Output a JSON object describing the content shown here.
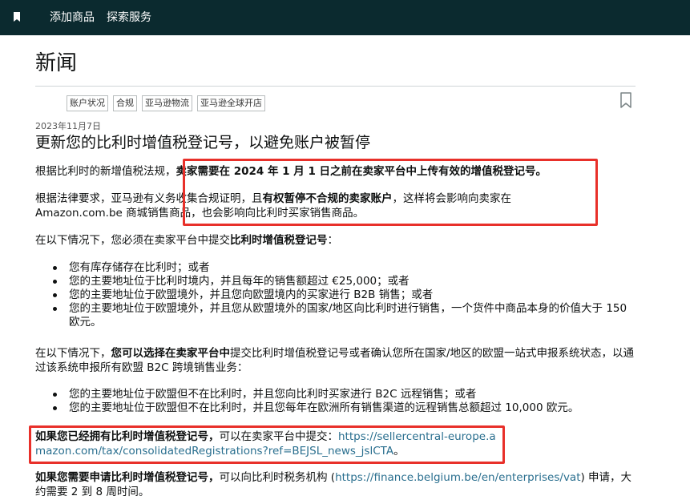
{
  "topbar": {
    "icon": "bookmark-icon",
    "links": [
      "添加商品",
      "探索服务"
    ]
  },
  "page": {
    "title": "新闻",
    "tags": [
      "账户状况",
      "合规",
      "亚马逊物流",
      "亚马逊全球开店"
    ],
    "save_icon": "bookmark-outline-icon",
    "date": "2023年11月7日",
    "headline": "更新您的比利时增值税登记号，以避免账户被暂停"
  },
  "article": {
    "p1_prefix": "根据比利时的新增值税法规，",
    "p1_bold": "卖家需要在 2024 年 1 月 1 日之前在卖家平台中上传有效的增值税登记号。",
    "p2_prefix": "根据法律要求，亚马逊有义务收集合规证明，且",
    "p2_bold": "有权暂停不合规的卖家账户",
    "p2_suffix": "，这样将会影响向卖家在 Amazon.com.be 商城销售商品，也会影响向比利时买家销售商品。",
    "p3_prefix": "在以下情况下，您必须在卖家平台中提交",
    "p3_bold": "比利时增值税登记号",
    "p3_suffix": "：",
    "list1": [
      "您有库存储存在比利时；或者",
      "您的主要地址位于比利时境内，并且每年的销售额超过 €25,000；或者",
      "您的主要地址位于欧盟境外，并且您向欧盟境内的买家进行 B2B 销售；或者",
      "您的主要地址位于欧盟境外，并且您从欧盟境外的国家/地区向比利时进行销售，一个货件中商品本身的价值大于 150 欧元。"
    ],
    "p4_prefix": "在以下情况下，",
    "p4_bold": "您可以选择在卖家平台中",
    "p4_suffix": "提交比利时增值税登记号或者确认您所在国家/地区的欧盟一站式申报系统状态，以通过该系统申报所有欧盟 B2C 跨境销售业务：",
    "list2": [
      "您的主要地址位于欧盟但不在比利时，并且您向比利时买家进行 B2C 远程销售；或者",
      "您的主要地址位于欧盟但不在比利时，并且您每年在欧洲所有销售渠道的远程销售总额超过 10,000 欧元。"
    ],
    "p5_bold": "如果您已经拥有比利时增值税登记号，",
    "p5_mid": "可以在卖家平台中提交：",
    "p5_link": "https://sellercentral-europe.amazon.com/tax/consolidatedRegistrations?ref=BEJSL_news_jslCTA",
    "p5_end": "。",
    "p6_bold": "如果您需要申请比利时增值税登记号，",
    "p6_mid": "可以向比利时税务机构 (",
    "p6_link": "https://finance.belgium.be/en/enterprises/vat",
    "p6_suffix": ") 申请，大约需要 2 到 8 周时间。"
  },
  "colors": {
    "topbar": "#0b2a2f",
    "highlight": "#e8302a",
    "link": "#2a6f8f"
  }
}
